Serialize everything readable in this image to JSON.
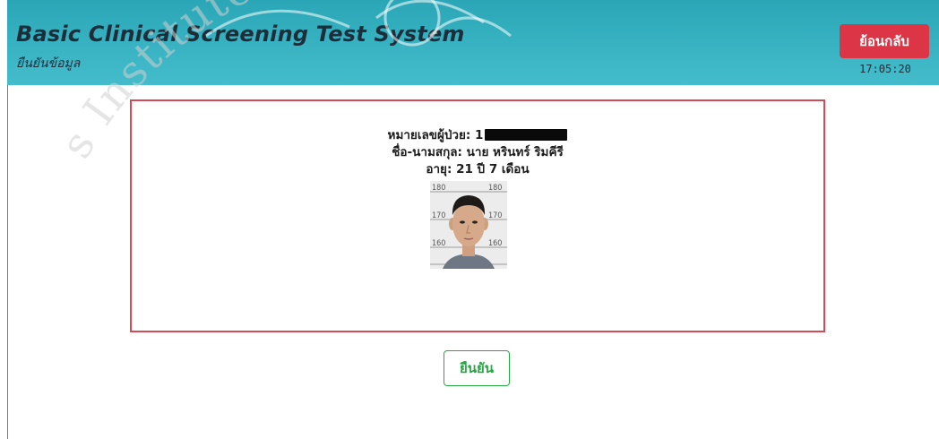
{
  "header": {
    "title": "Basic Clinical Screening Test System",
    "subtitle": "ยืนยันข้อมูล",
    "back_label": "ย้อนกลับ",
    "clock": "17:05:20"
  },
  "patient": {
    "id_label": "หมายเลขผู้ป่วย:",
    "id_visible_prefix": "1",
    "name_label": "ชื่อ-นามสกุล:",
    "name_value": "นาย หรินทร์ ริมคีรี",
    "age_label": "อายุ:",
    "age_value": "21 ปี 7 เดือน",
    "photo_scale_ticks": [
      "180",
      "170",
      "160"
    ]
  },
  "actions": {
    "confirm_label": "ยืนยัน"
  },
  "colors": {
    "header_bg": "#35b0bf",
    "back_button": "#dc3545",
    "confirm_button": "#28a745",
    "box_border": "#d04c5a"
  }
}
